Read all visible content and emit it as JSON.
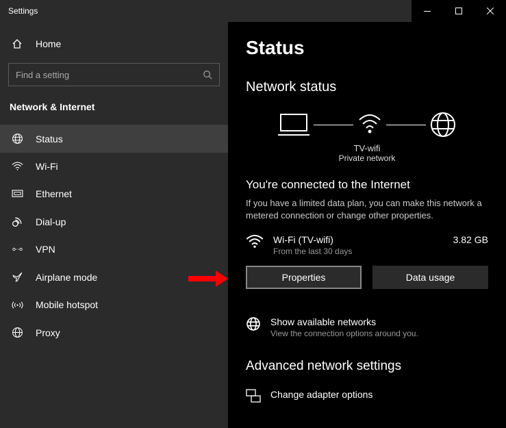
{
  "titlebar": {
    "title": "Settings"
  },
  "sidebar": {
    "home": "Home",
    "search_placeholder": "Find a setting",
    "group": "Network & Internet",
    "items": [
      {
        "label": "Status"
      },
      {
        "label": "Wi-Fi"
      },
      {
        "label": "Ethernet"
      },
      {
        "label": "Dial-up"
      },
      {
        "label": "VPN"
      },
      {
        "label": "Airplane mode"
      },
      {
        "label": "Mobile hotspot"
      },
      {
        "label": "Proxy"
      }
    ]
  },
  "main": {
    "title": "Status",
    "subtitle": "Network status",
    "diagram": {
      "ssid": "TV-wifi",
      "network_type": "Private network"
    },
    "connected": {
      "heading": "You're connected to the Internet",
      "description": "If you have a limited data plan, you can make this network a metered connection or change other properties.",
      "connection_name": "Wi-Fi (TV-wifi)",
      "period": "From the last 30 days",
      "data_used": "3.82 GB",
      "properties_btn": "Properties",
      "data_usage_btn": "Data usage"
    },
    "available": {
      "title": "Show available networks",
      "subtitle": "View the connection options around you."
    },
    "advanced": {
      "heading": "Advanced network settings",
      "adapter_title": "Change adapter options"
    }
  }
}
